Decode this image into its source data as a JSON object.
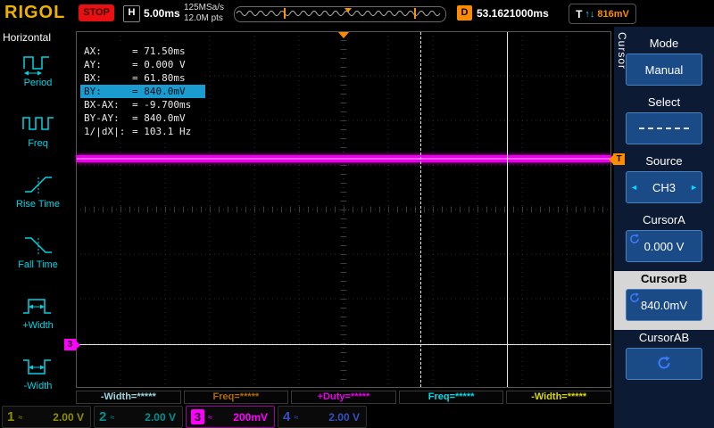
{
  "top_bar": {
    "logo": "RIGOL",
    "run_state": "STOP",
    "h_label": "H",
    "timebase": "5.00ms",
    "sample_rate": "125MSa/s",
    "memory_depth": "12.0M pts",
    "delay_label": "D",
    "delay_value": "53.1621000ms",
    "trigger_label": "T",
    "trigger_slope": "↑↓",
    "trigger_level": "816mV"
  },
  "left_menu": {
    "title": "Horizontal",
    "items": [
      {
        "label": "Period"
      },
      {
        "label": "Freq"
      },
      {
        "label": "Rise Time"
      },
      {
        "label": "Fall Time"
      },
      {
        "label": "+Width"
      },
      {
        "label": "-Width"
      }
    ]
  },
  "cursor_info": {
    "rows": [
      {
        "label": "AX:",
        "value": "= 71.50ms"
      },
      {
        "label": "AY:",
        "value": "= 0.000 V"
      },
      {
        "label": "BX:",
        "value": "= 61.80ms"
      },
      {
        "label": "BY:",
        "value": "= 840.0mV"
      },
      {
        "label": "BX-AX:",
        "value": "= -9.700ms"
      },
      {
        "label": "BY-AY:",
        "value": "= 840.0mV"
      },
      {
        "label": "1/|dX|:",
        "value": "= 103.1 Hz"
      }
    ]
  },
  "markers": {
    "trigger_tag": "T",
    "channel_tag": "3"
  },
  "measurements": [
    {
      "label": "-Width=*****",
      "color": "#9fd4dc"
    },
    {
      "label": "Freq=*****",
      "color": "#b06a00"
    },
    {
      "label": "+Duty=*****",
      "color": "#e800e8"
    },
    {
      "label": "Freq=*****",
      "color": "#00dce8"
    },
    {
      "label": "-Width=*****",
      "color": "#d8d800"
    }
  ],
  "channel_bar": {
    "channels": [
      {
        "num": "1",
        "coupling": "≈",
        "scale": "2.00 V",
        "color": "#8f8f00"
      },
      {
        "num": "2",
        "coupling": "≈",
        "scale": "2.00 V",
        "color": "#009090"
      },
      {
        "num": "3",
        "coupling": "≈",
        "scale": "200mV",
        "color": "#ff00ff"
      },
      {
        "num": "4",
        "coupling": "≈",
        "scale": "2.00 V",
        "color": "#3450c0"
      }
    ]
  },
  "right_menu": {
    "title": "Cursor",
    "icons": {
      "arrow_left": "◄",
      "arrow_right": "►"
    },
    "items": [
      {
        "label": "Mode",
        "value": "Manual"
      },
      {
        "label": "Select",
        "value": ""
      },
      {
        "label": "Source",
        "value": "CH3"
      },
      {
        "label": "CursorA",
        "value": "0.000 V"
      },
      {
        "label": "CursorB",
        "value": "840.0mV"
      },
      {
        "label": "CursorAB",
        "value": ""
      }
    ]
  },
  "colors": {
    "accent_orange": "#ff8c00",
    "accent_cyan": "#00d4e4",
    "ch3_trace": "#ff00ff",
    "cursor_line": "#e8e8e8",
    "highlight_row": "#1a9cd0"
  }
}
